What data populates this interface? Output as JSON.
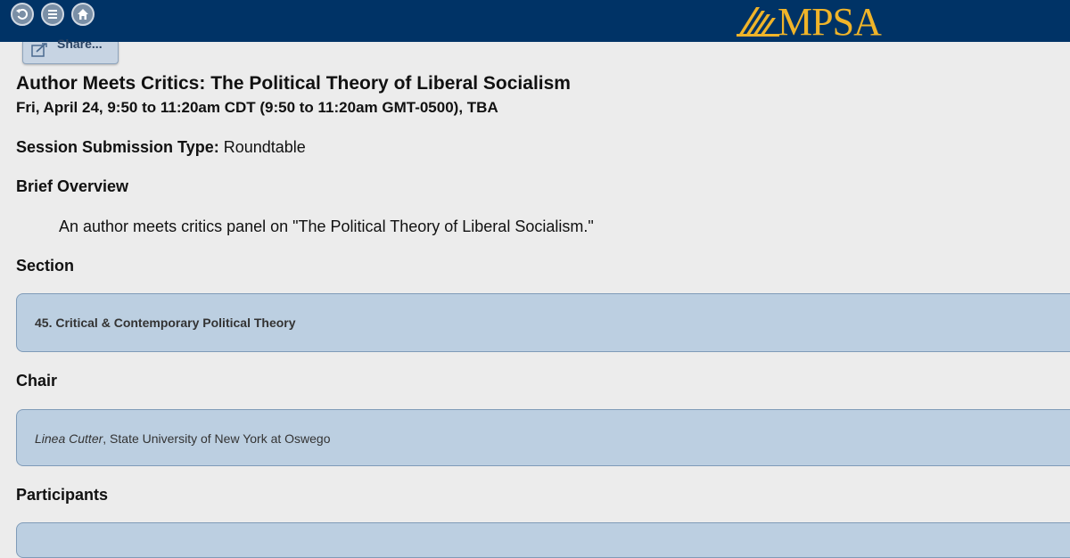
{
  "nav": {
    "back_icon": "back-arrow-icon",
    "menu_icon": "menu-icon",
    "home_icon": "home-icon"
  },
  "logo": {
    "text": "MPSA",
    "color": "#f0b429"
  },
  "share": {
    "label": "Share..."
  },
  "session": {
    "title": "Author Meets Critics: The Political Theory of Liberal Socialism",
    "datetime": "Fri, April 24, 9:50 to 11:20am CDT (9:50 to 11:20am GMT-0500), TBA",
    "submission_type_label": "Session Submission Type:",
    "submission_type_value": "Roundtable"
  },
  "overview": {
    "heading": "Brief Overview",
    "text": "An author meets critics panel on \"The Political Theory of Liberal Socialism.\""
  },
  "section": {
    "heading": "Section",
    "value": "45. Critical & Contemporary Political Theory"
  },
  "chair": {
    "heading": "Chair",
    "name": "Linea Cutter",
    "affiliation": ", State University of New York at Oswego"
  },
  "participants": {
    "heading": "Participants"
  },
  "colors": {
    "topbar": "#003366",
    "panel_bg": "#bccfe1",
    "accent_gold": "#f0b429"
  }
}
